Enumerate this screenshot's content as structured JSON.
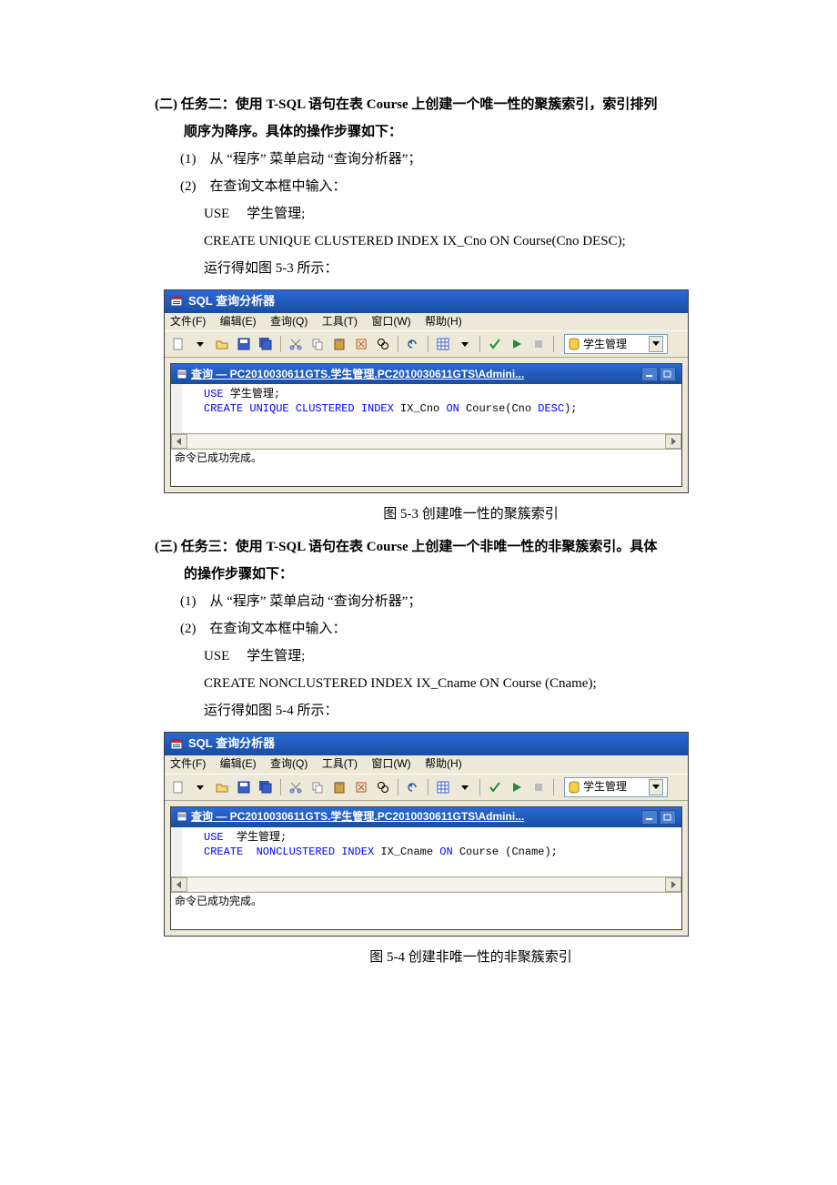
{
  "task2": {
    "title_l1": "(二) 任务二：使用 T-SQL 语句在表 Course 上创建一个唯一性的聚簇索引，索引排列",
    "title_l2": "顺序为降序。具体的操作步骤如下：",
    "step1": "(1)　从 “程序” 菜单启动 “查询分析器”；",
    "step2": "(2)　在查询文本框中输入：",
    "line1": "USE　 学生管理;",
    "line2": "CREATE UNIQUE CLUSTERED INDEX IX_Cno ON Course(Cno DESC);",
    "line3": "运行得如图 5-3 所示："
  },
  "app1": {
    "title": "SQL 查询分析器",
    "menus": {
      "file": "文件(F)",
      "edit": "编辑(E)",
      "query": "查询(Q)",
      "tools": "工具(T)",
      "window": "窗口(W)",
      "help": "帮助(H)"
    },
    "db": "学生管理",
    "inner_title": "查询 — PC2010030611GTS.学生管理.PC2010030611GTS\\Admini...",
    "sql": {
      "l1a": "USE ",
      "l1b": "学生管理",
      "l1c": ";",
      "l2a": "CREATE UNIQUE CLUSTERED INDEX",
      "l2b": " IX_Cno ",
      "l2c": "ON",
      "l2d": " Course(Cno ",
      "l2e": "DESC",
      "l2f": ");"
    },
    "result": "命令已成功完成。"
  },
  "caption1": "图 5-3 创建唯一性的聚簇索引",
  "task3": {
    "title_l1": "(三) 任务三：使用 T-SQL 语句在表 Course 上创建一个非唯一性的非聚簇索引。具体",
    "title_l2": "的操作步骤如下：",
    "step1": "(1)　从 “程序” 菜单启动 “查询分析器”；",
    "step2": "(2)　在查询文本框中输入：",
    "line1": "USE　 学生管理;",
    "line2": "CREATE NONCLUSTERED INDEX IX_Cname ON Course (Cname);",
    "line3": "运行得如图 5-4 所示："
  },
  "app2": {
    "title": "SQL 查询分析器",
    "menus": {
      "file": "文件(F)",
      "edit": "编辑(E)",
      "query": "查询(Q)",
      "tools": "工具(T)",
      "window": "窗口(W)",
      "help": "帮助(H)"
    },
    "db": "学生管理",
    "inner_title": "查询 — PC2010030611GTS.学生管理.PC2010030611GTS\\Admini...",
    "sql": {
      "l1a": "USE ",
      "l1b": " 学生管理",
      "l1c": ";",
      "l2a": "CREATE  NONCLUSTERED INDEX",
      "l2b": " IX_Cname ",
      "l2c": "ON",
      "l2d": " Course (Cname);"
    },
    "result": "命令已成功完成。"
  },
  "caption2": "图 5-4 创建非唯一性的非聚簇索引"
}
